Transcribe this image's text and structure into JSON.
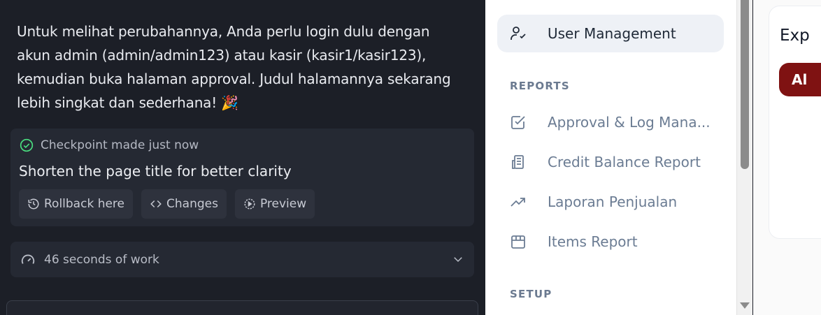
{
  "chat": {
    "message": "Untuk melihat perubahannya, Anda perlu login dulu dengan akun admin (admin/admin123) atau kasir (kasir1/kasir123), kemudian buka halaman approval. Judul halamannya sekarang lebih singkat dan sederhana! 🎉",
    "checkpoint": {
      "status": "Checkpoint made just now",
      "title": "Shorten the page title for better clarity",
      "rollback_label": "Rollback here",
      "changes_label": "Changes",
      "preview_label": "Preview"
    },
    "work_summary": "46 seconds of work"
  },
  "sidebar": {
    "sections": {
      "reports": "REPORTS",
      "setup": "SETUP"
    },
    "items": [
      {
        "label": "User Management",
        "icon": "user-check-icon",
        "active": true
      },
      {
        "label": "Approval & Log Mana...",
        "icon": "checkbox-icon",
        "active": false
      },
      {
        "label": "Credit Balance Report",
        "icon": "building-receipt-icon",
        "active": false
      },
      {
        "label": "Laporan Penjualan",
        "icon": "trending-up-icon",
        "active": false
      },
      {
        "label": "Items Report",
        "icon": "package-icon",
        "active": false
      }
    ]
  },
  "main": {
    "card_title": "Exp",
    "pill_label": "Al"
  },
  "colors": {
    "chat_bg": "#1c1f27",
    "panel_bg": "#252933",
    "accent_red": "#7f1212",
    "active_nav_bg": "#eef1f6",
    "checkpoint_green": "#4ade80"
  }
}
